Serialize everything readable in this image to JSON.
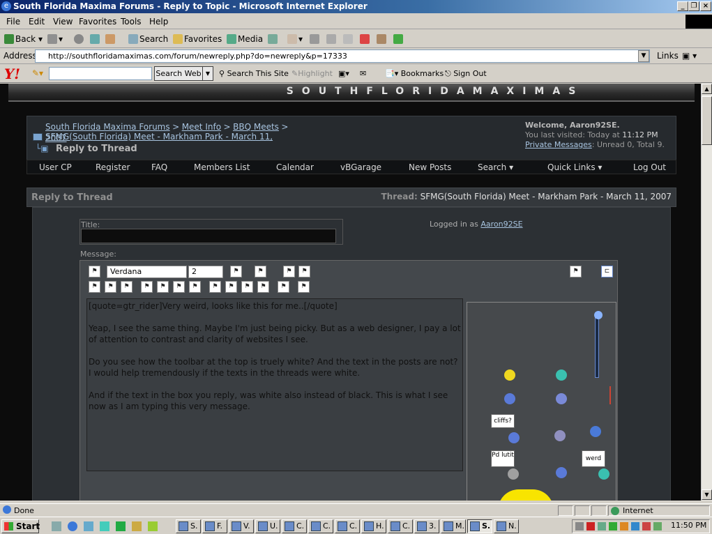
{
  "window": {
    "title": "South Florida Maxima Forums - Reply to Topic - Microsoft Internet Explorer",
    "icon": "ie-icon"
  },
  "menu": [
    "File",
    "Edit",
    "View",
    "Favorites",
    "Tools",
    "Help"
  ],
  "toolbar": {
    "back": "Back",
    "search": "Search",
    "favorites": "Favorites",
    "media": "Media"
  },
  "address": {
    "label": "Address",
    "url": "http://southfloridamaximas.com/forum/newreply.php?do=newreply&p=17333",
    "links": "Links"
  },
  "yahoo": {
    "logo": "Y!",
    "search_button": "Search Web",
    "search_site": "Search This Site",
    "highlight": "Highlight",
    "bookmarks": "Bookmarks",
    "signout": "Sign Out"
  },
  "forum": {
    "banner": "SOUTHFLORIDAMAXIMAS",
    "breadcrumbs": [
      "South Florida Maxima Forums",
      "Meet Info",
      "BBQ Meets",
      "SFMG(South Florida) Meet - Markham Park - March 11,"
    ],
    "breadcrumb_wrap": "2007",
    "breadcrumb_sep": ">",
    "page_heading": "Reply to Thread",
    "welcome": "Welcome, Aaron92SE.",
    "last_visited_label": "You last visited: Today at ",
    "last_visited_time": "11:12 PM",
    "private_messages": "Private Messages",
    "pm_counts": ": Unread 0, Total 9.",
    "nav": [
      "User CP",
      "Register",
      "FAQ",
      "Members List",
      "Calendar",
      "vBGarage",
      "New Posts",
      "Search",
      "Quick Links",
      "Log Out"
    ],
    "reply_title": "Reply to Thread",
    "thread_label": "Thread:",
    "thread_name": "SFMG(South Florida) Meet - Markham Park - March 11, 2007",
    "title_label": "Title:",
    "logged_in_label": "Logged in as ",
    "logged_in_user": "Aaron92SE",
    "message_label": "Message:",
    "font_value": "Verdana",
    "size_value": "2",
    "message_lines": [
      "[quote=gtr_rider]Very weird, looks like this for me..[/quote]",
      "Yeap, I see the same thing.  Maybe I'm just being picky.  But as a web designer, I pay a lot of attention to contrast and clarity of websites I see.",
      "Do you see how the toolbar at the top is truely white?  And the text in the posts are not?  I would help tremendously if the texts in the threads were white.",
      "And if the text in the box you reply, was white also instead of black.  This is what I see now as I am typing this very message."
    ],
    "smilie_signs": [
      "cliffs?",
      "Pd lutit",
      "werd"
    ]
  },
  "status": {
    "text": "Done",
    "zone": "Internet"
  },
  "taskbar": {
    "start": "Start",
    "tasks": [
      "S.",
      "F.",
      "V.",
      "U.",
      "C.",
      "C.",
      "C.",
      "H.",
      "C.",
      "3.",
      "M.",
      "S.",
      "N."
    ],
    "clock": "11:50 PM"
  }
}
